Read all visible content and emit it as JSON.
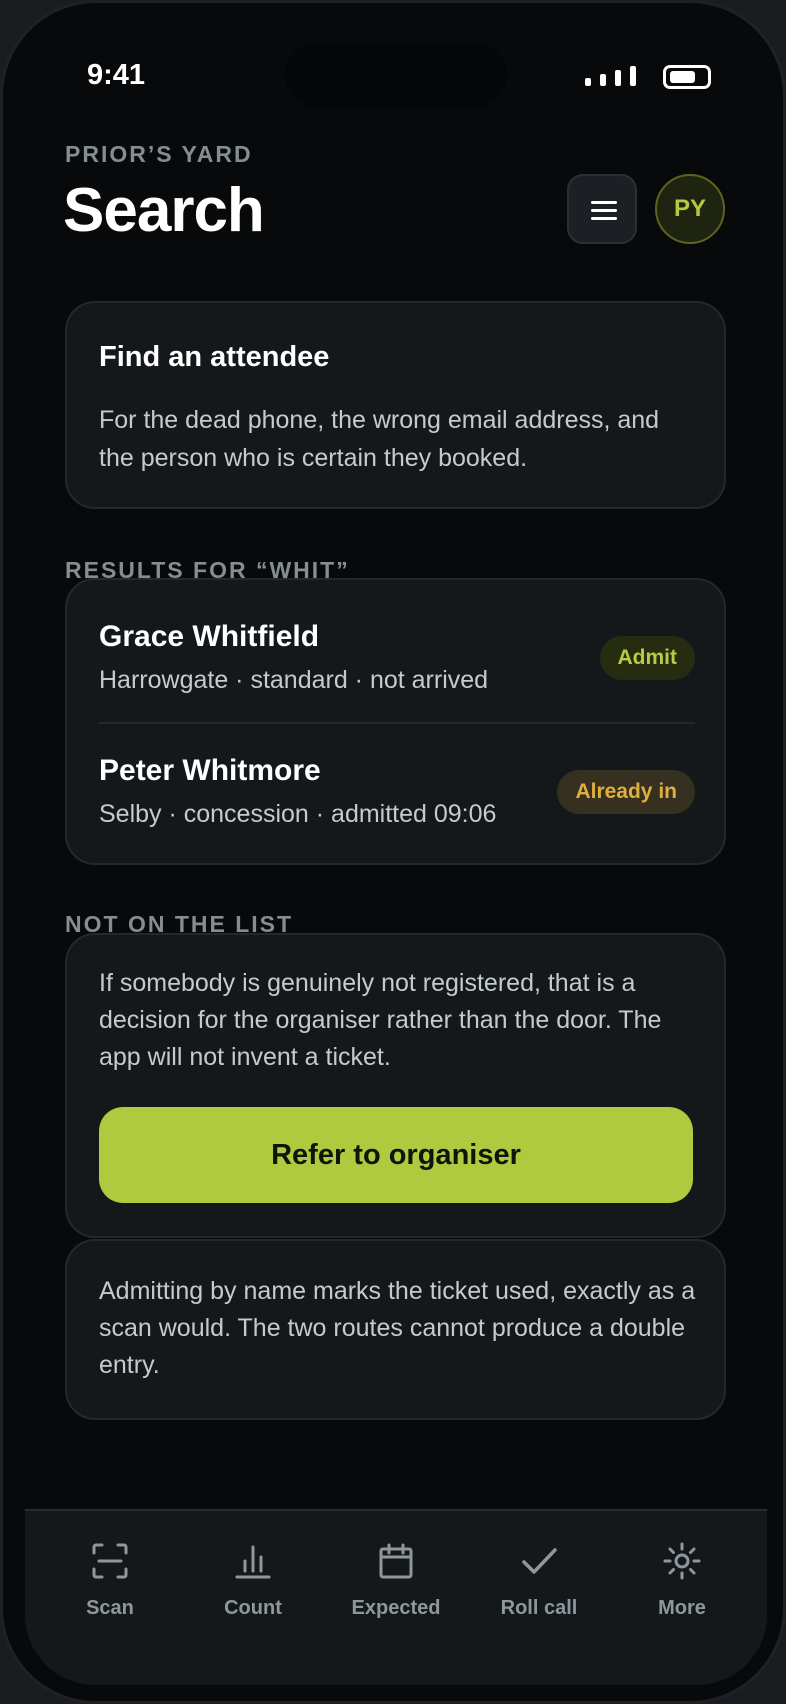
{
  "status_bar": {
    "time": "9:41"
  },
  "header": {
    "eyebrow": "PRIOR’S YARD",
    "title": "Search",
    "avatar_initials": "PY",
    "menu_icon": "hamburger-icon"
  },
  "intro": {
    "title": "Find an attendee",
    "text": "For the dead phone, the wrong email address, and the person who is certain they booked."
  },
  "results": {
    "label": "RESULTS FOR “WHIT”",
    "items": [
      {
        "name": "Grace Whitfield",
        "meta": "Harrowgate · standard · not arrived",
        "badge": "Admit"
      },
      {
        "name": "Peter Whitmore",
        "meta": "Selby · concession · admitted 09:06",
        "badge": "Already in"
      }
    ]
  },
  "not_on_list": {
    "label": "NOT ON THE LIST",
    "text": "If somebody is genuinely not registered, that is a decision for the organiser rather than the door. The app will not invent a ticket.",
    "button": "Refer to organiser"
  },
  "footnote": {
    "text": "Admitting by name marks the ticket used, exactly as a scan would. The two routes cannot produce a double entry."
  },
  "tabbar": {
    "tabs": [
      {
        "label": "Scan",
        "icon": "scan-icon"
      },
      {
        "label": "Count",
        "icon": "bar-chart-icon"
      },
      {
        "label": "Expected",
        "icon": "calendar-icon"
      },
      {
        "label": "Roll call",
        "icon": "checkmark-icon"
      },
      {
        "label": "More",
        "icon": "gear-icon"
      }
    ]
  },
  "colors": {
    "background": "#08090b",
    "card": "#15181b",
    "accent": "#b0ca40",
    "warning": "#e0ae3e",
    "muted": "#848e92"
  }
}
